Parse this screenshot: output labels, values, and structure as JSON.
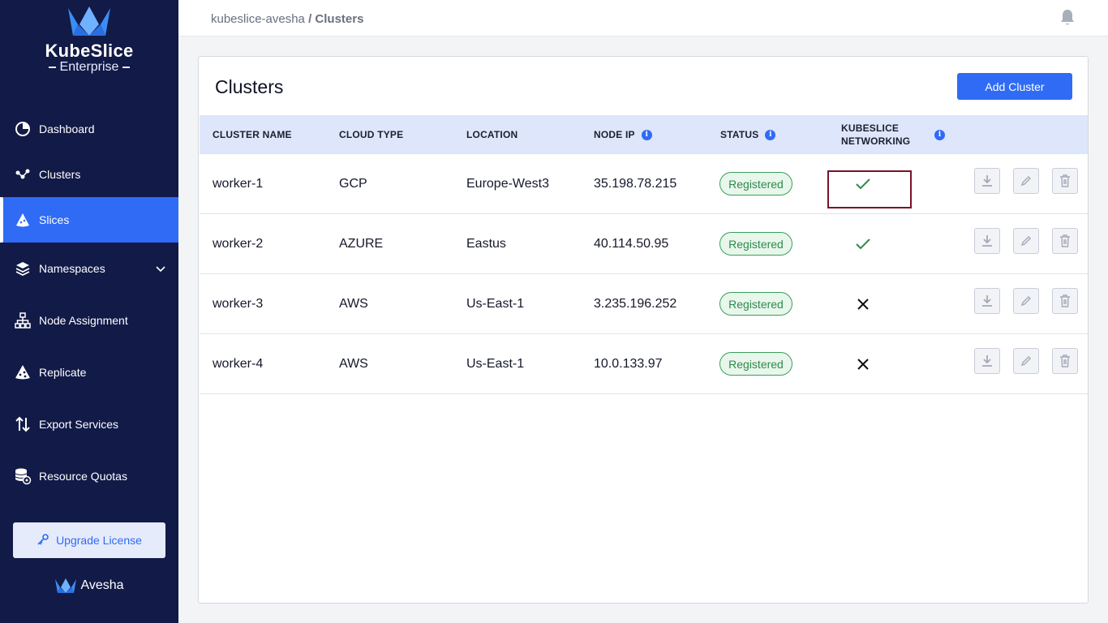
{
  "brand": {
    "name": "KubeSlice",
    "edition": "Enterprise",
    "footer_name": "Avesha"
  },
  "sidebar": {
    "items": [
      {
        "label": "Dashboard",
        "icon": "pie-chart-icon"
      },
      {
        "label": "Clusters",
        "icon": "clusters-icon"
      },
      {
        "label": "Slices",
        "icon": "slices-icon",
        "active": true
      },
      {
        "label": "Namespaces",
        "icon": "layers-icon",
        "expandable": true
      },
      {
        "label": "Node Assignment",
        "icon": "sitemap-icon"
      },
      {
        "label": "Replicate",
        "icon": "replicate-icon"
      },
      {
        "label": "Export Services",
        "icon": "arrows-up-down-icon"
      },
      {
        "label": "Resource Quotas",
        "icon": "database-gear-icon"
      }
    ],
    "upgrade_label": "Upgrade License"
  },
  "header": {
    "breadcrumb_root": "kubeslice-avesha",
    "breadcrumb_separator": " / ",
    "breadcrumb_current": "Clusters"
  },
  "page": {
    "title": "Clusters",
    "add_button": "Add Cluster",
    "columns": {
      "name": "CLUSTER NAME",
      "cloud": "CLOUD TYPE",
      "location": "LOCATION",
      "node_ip": "NODE IP",
      "status": "STATUS",
      "networking_line1": "KUBESLICE",
      "networking_line2": "NETWORKING"
    },
    "rows": [
      {
        "name": "worker-1",
        "cloud": "GCP",
        "location": "Europe-West3",
        "node_ip": "35.198.78.215",
        "status": "Registered",
        "networking": true
      },
      {
        "name": "worker-2",
        "cloud": "AZURE",
        "location": "Eastus",
        "node_ip": "40.114.50.95",
        "status": "Registered",
        "networking": true
      },
      {
        "name": "worker-3",
        "cloud": "AWS",
        "location": "Us-East-1",
        "node_ip": "3.235.196.252",
        "status": "Registered",
        "networking": false
      },
      {
        "name": "worker-4",
        "cloud": "AWS",
        "location": "Us-East-1",
        "node_ip": "10.0.133.97",
        "status": "Registered",
        "networking": false
      }
    ]
  },
  "colors": {
    "sidebar_bg": "#121a47",
    "accent": "#2f6bf5",
    "status_green": "#2e8a4b",
    "highlight": "#7a1227"
  }
}
